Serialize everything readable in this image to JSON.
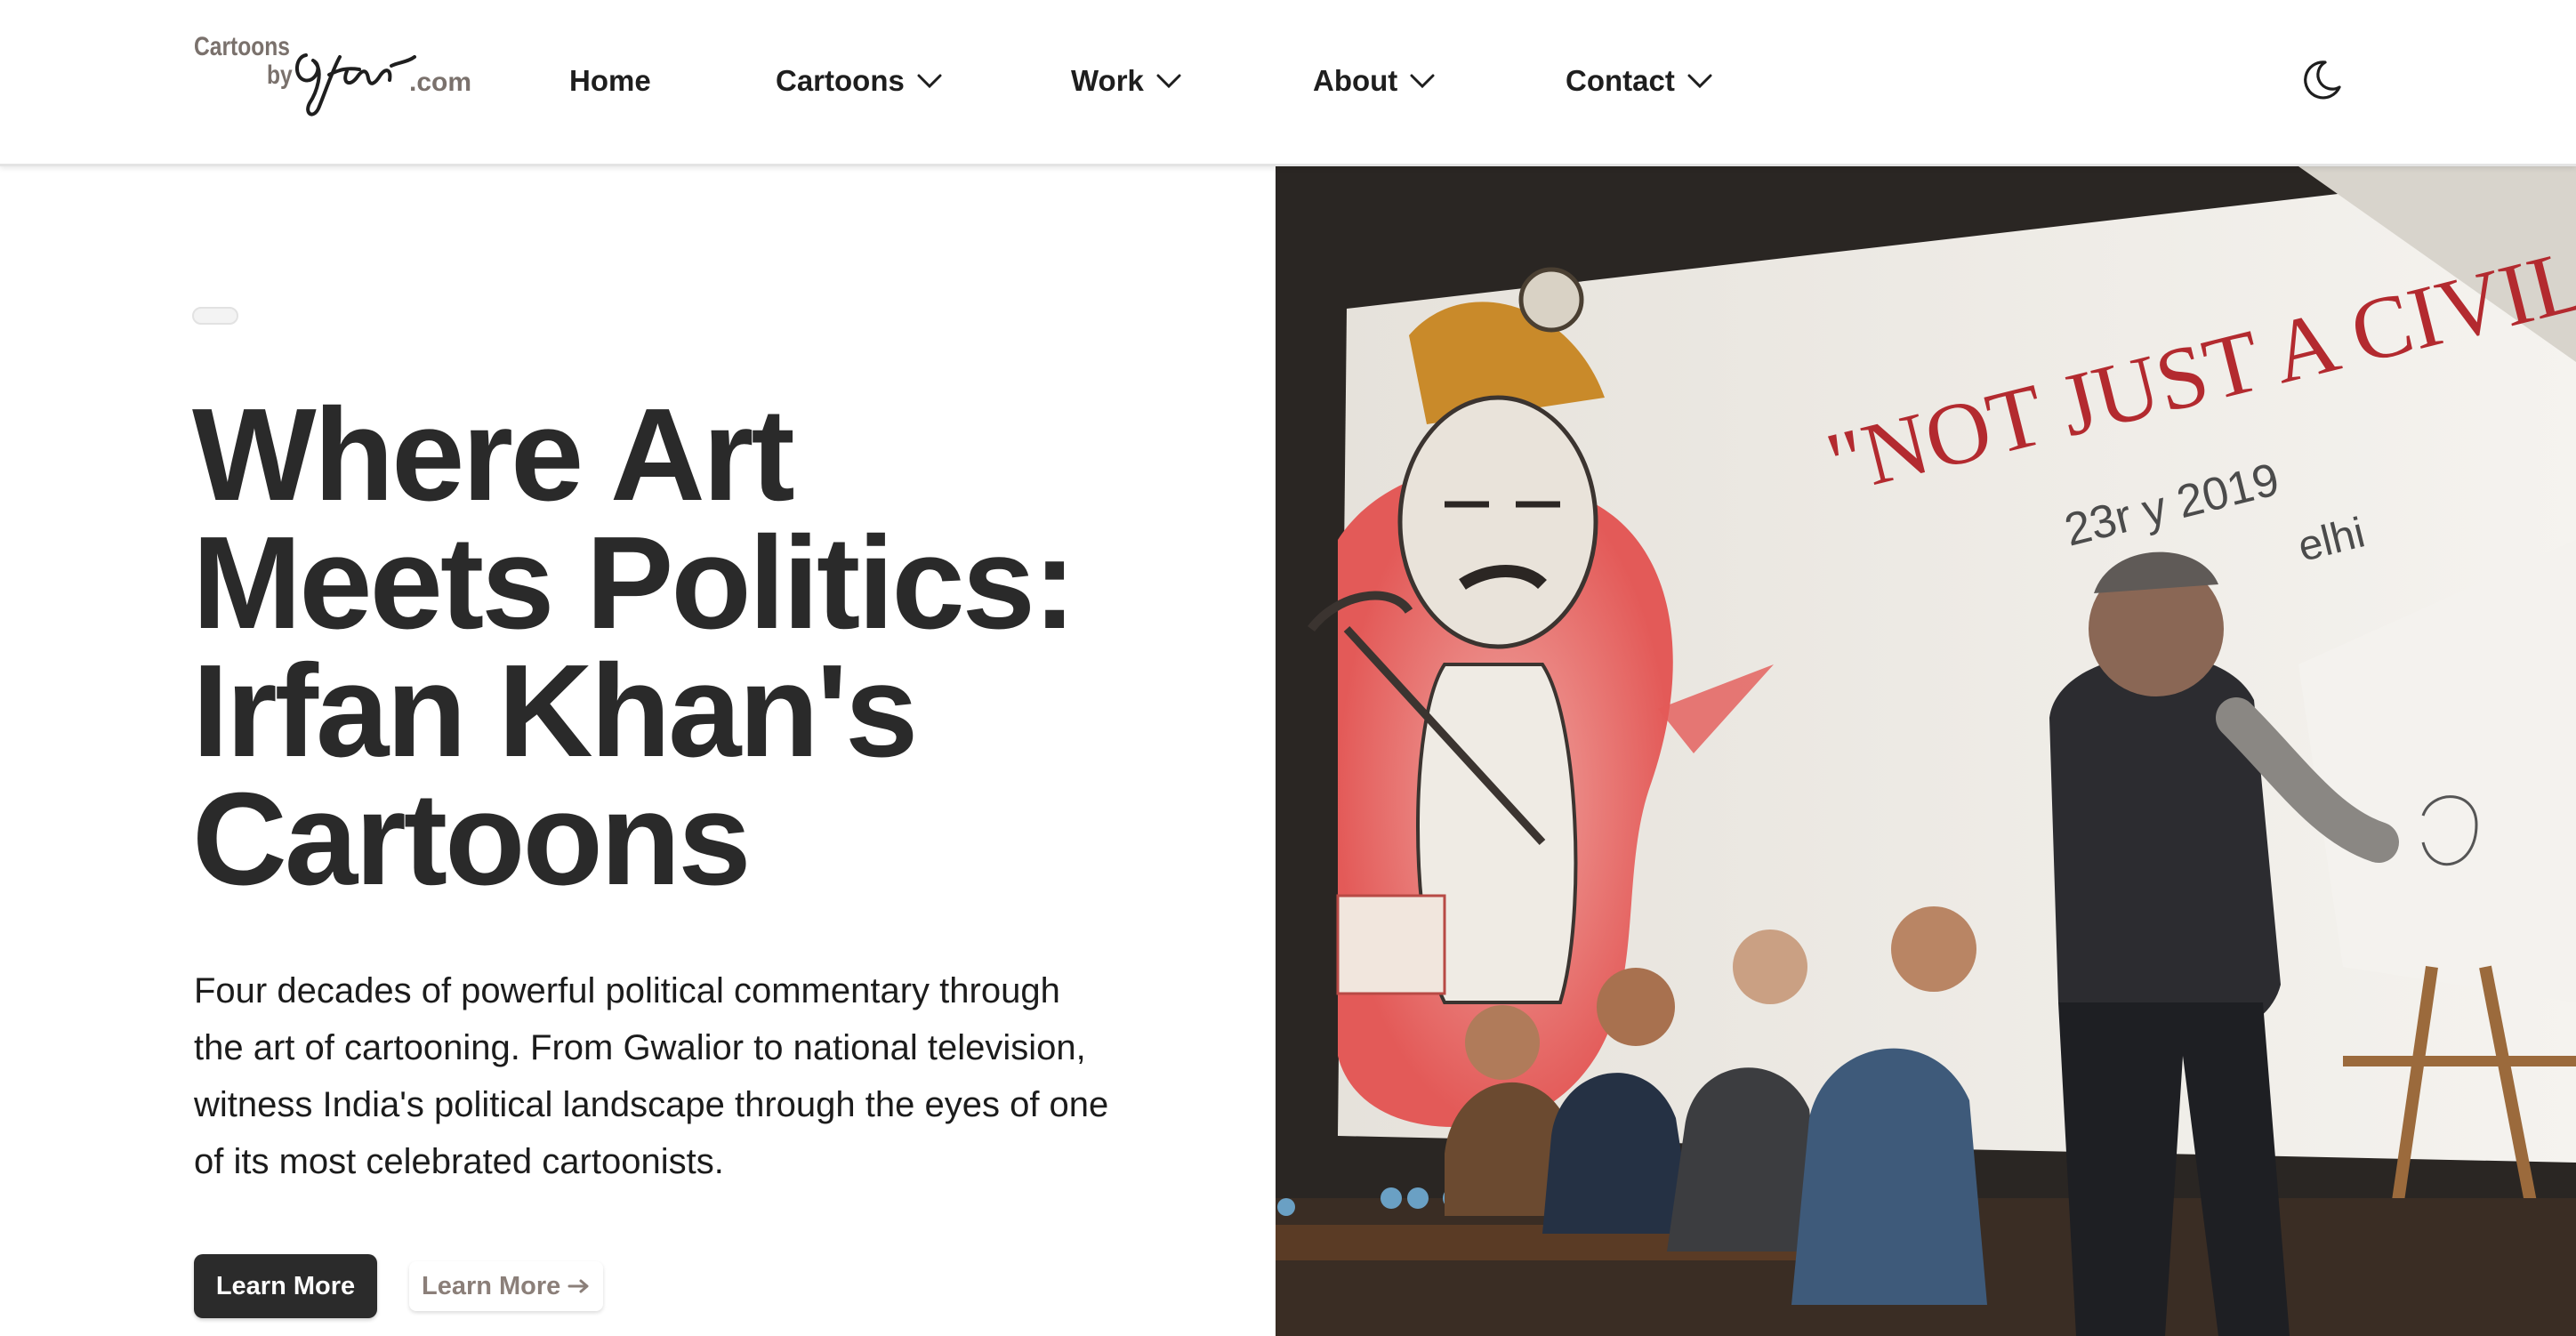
{
  "logo": {
    "line1": "Cartoons",
    "line2": "by",
    "signature": "Irfan",
    "suffix": ".com"
  },
  "nav": {
    "items": [
      {
        "label": "Home",
        "has_dropdown": false
      },
      {
        "label": "Cartoons",
        "has_dropdown": true
      },
      {
        "label": "Work",
        "has_dropdown": true
      },
      {
        "label": "About",
        "has_dropdown": true
      },
      {
        "label": "Contact",
        "has_dropdown": true
      }
    ],
    "theme_icon": "moon-icon"
  },
  "hero": {
    "title_lines": [
      "Where Art",
      "Meets Politics:",
      "Irfan Khan's",
      "Cartoons"
    ],
    "subtitle": "Four decades of powerful political commentary through the art of cartooning. From Gwalior to national television, witness India's political landscape through the eyes of one of its most celebrated cartoonists.",
    "primary_button": "Learn More",
    "secondary_button": "Learn More",
    "secondary_icon": "arrow-right-icon"
  },
  "photo": {
    "banner_text": "\"NOT JUST A CIVIL SERV",
    "banner_date": "23r        y 2019",
    "banner_place": "elhi"
  },
  "colors": {
    "text_dark": "#262626",
    "button_dark": "#2b2b2b",
    "muted_brown": "#8b7f79"
  }
}
